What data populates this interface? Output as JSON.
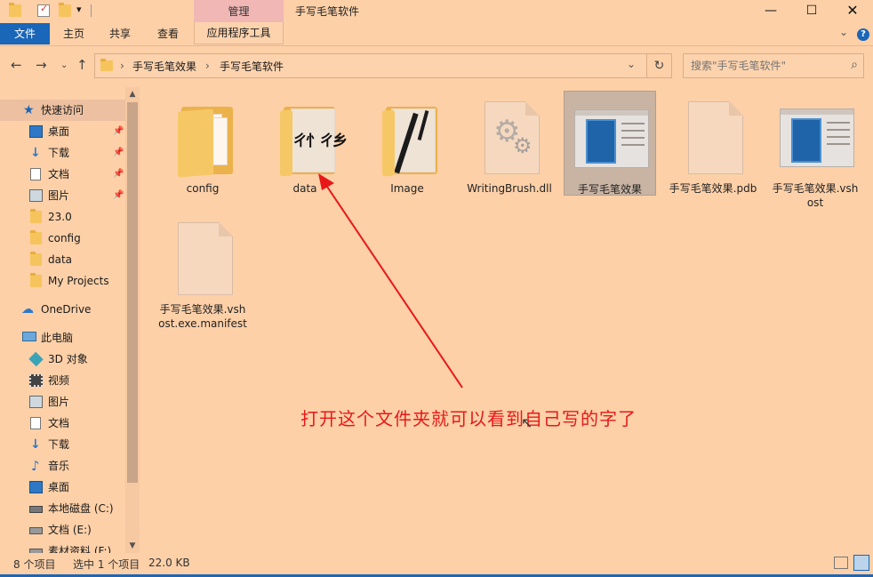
{
  "titlebar": {
    "manage_tab": "管理",
    "window_title": "手写毛笔软件",
    "qat_dropdown": "▾"
  },
  "ribbon": {
    "tabs": [
      "文件",
      "主页",
      "共享",
      "查看",
      "应用程序工具"
    ],
    "collapse": "⌄",
    "help": "?"
  },
  "address": {
    "crumbs": [
      "手写毛笔效果",
      "手写毛笔软件"
    ],
    "search_placeholder": "搜索\"手写毛笔软件\""
  },
  "sidebar": {
    "quick_access": "快速访问",
    "items": [
      {
        "label": "桌面",
        "pinned": true
      },
      {
        "label": "下载",
        "pinned": true
      },
      {
        "label": "文档",
        "pinned": true
      },
      {
        "label": "图片",
        "pinned": true
      },
      {
        "label": "23.0"
      },
      {
        "label": "config"
      },
      {
        "label": "data"
      },
      {
        "label": "My Projects"
      }
    ],
    "onedrive": "OneDrive",
    "this_pc": "此电脑",
    "pc_items": [
      "3D 对象",
      "视频",
      "图片",
      "文档",
      "下载",
      "音乐",
      "桌面",
      "本地磁盘 (C:)",
      "文档 (E:)",
      "素材资料 (F:)"
    ]
  },
  "files": [
    {
      "name": "config",
      "type": "folder"
    },
    {
      "name": "data",
      "type": "folder"
    },
    {
      "name": "Image",
      "type": "folder"
    },
    {
      "name": "WritingBrush.dll",
      "type": "dll"
    },
    {
      "name": "手写毛笔效果",
      "type": "exe",
      "selected": true
    },
    {
      "name": "手写毛笔效果.pdb",
      "type": "file"
    },
    {
      "name": "手写毛笔效果.vshost",
      "type": "exe"
    },
    {
      "name": "手写毛笔效果.vshost.exe.manifest",
      "type": "file"
    }
  ],
  "annotation": {
    "text": "打开这个文件夹就可以看到自己写的字了",
    "color": "#e81818"
  },
  "status": {
    "count": "8 个项目",
    "selected": "选中 1 个项目",
    "size": "22.0 KB"
  },
  "colors": {
    "accent": "#1a66b8",
    "background": "#fdd0a8"
  }
}
